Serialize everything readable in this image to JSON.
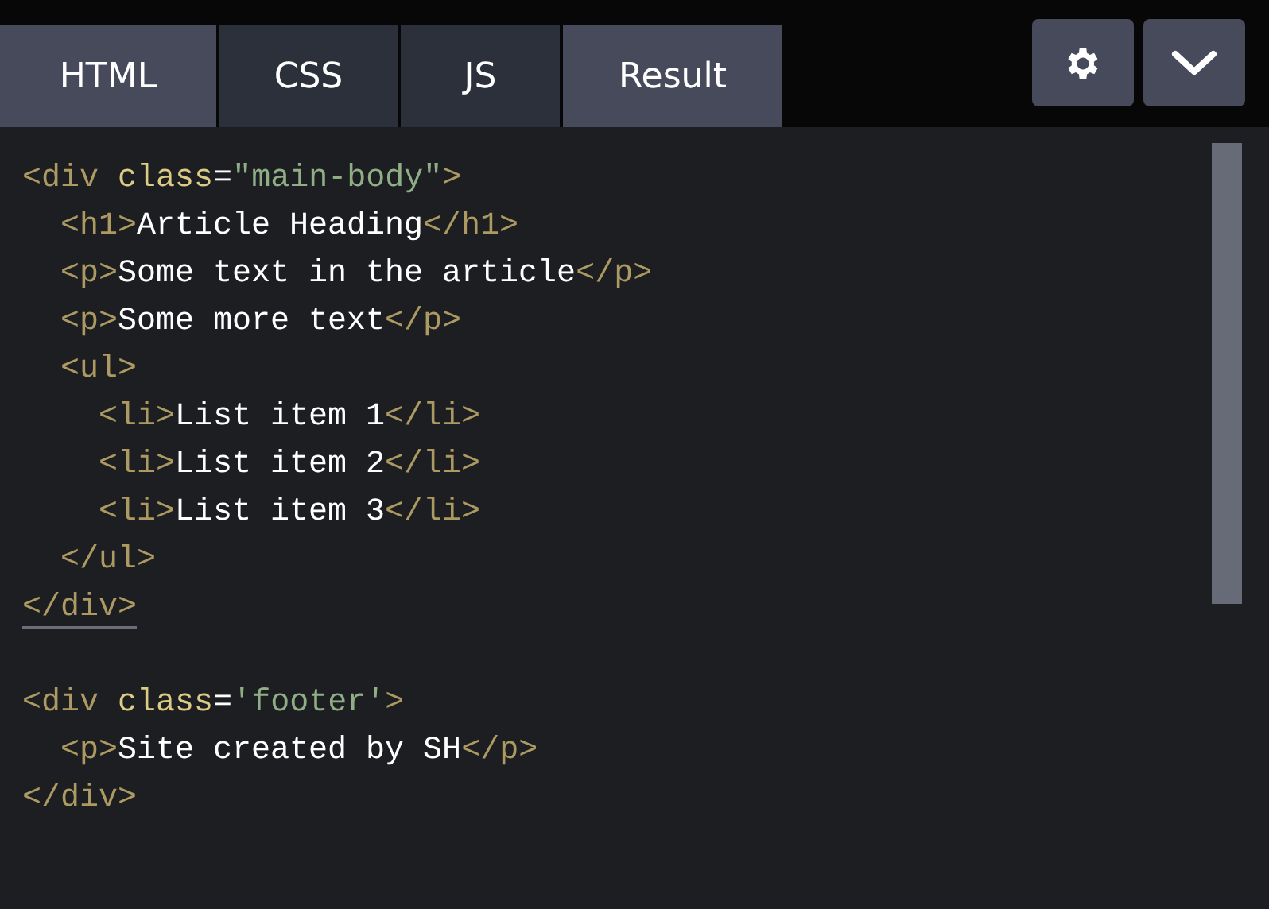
{
  "tabs": [
    {
      "label": "HTML",
      "selected": true
    },
    {
      "label": "CSS",
      "selected": false
    },
    {
      "label": "JS",
      "selected": false
    },
    {
      "label": "Result",
      "selected": true
    }
  ],
  "code_lines": [
    {
      "kind": "code",
      "matched": false,
      "tokens": [
        {
          "kind": "tag",
          "text": "<div"
        },
        {
          "kind": "attr",
          "text": "class"
        },
        {
          "kind": "text",
          "text": "="
        },
        {
          "kind": "string",
          "text": "\"main-body\""
        },
        {
          "kind": "tag",
          "text": ">"
        }
      ],
      "children": [
        {
          "kind": "code",
          "matched": false,
          "tokens": [
            {
              "kind": "tag",
              "text": "<h1>"
            },
            {
              "kind": "text",
              "text": "Article Heading"
            },
            {
              "kind": "tag",
              "text": "</h1>"
            }
          ]
        },
        {
          "kind": "code",
          "matched": false,
          "tokens": [
            {
              "kind": "tag",
              "text": "<p>"
            },
            {
              "kind": "text",
              "text": "Some text in the article"
            },
            {
              "kind": "tag",
              "text": "</p>"
            }
          ]
        },
        {
          "kind": "code",
          "matched": false,
          "tokens": [
            {
              "kind": "tag",
              "text": "<p>"
            },
            {
              "kind": "text",
              "text": "Some more text"
            },
            {
              "kind": "tag",
              "text": "</p>"
            }
          ]
        },
        {
          "kind": "code",
          "matched": false,
          "tokens": [
            {
              "kind": "tag",
              "text": "<ul>"
            }
          ],
          "children": [
            {
              "kind": "code",
              "matched": false,
              "tokens": [
                {
                  "kind": "tag",
                  "text": "<li>"
                },
                {
                  "kind": "text",
                  "text": "List item 1"
                },
                {
                  "kind": "tag",
                  "text": "</li>"
                }
              ]
            },
            {
              "kind": "code",
              "matched": false,
              "tokens": [
                {
                  "kind": "tag",
                  "text": "<li>"
                },
                {
                  "kind": "text",
                  "text": "List item 2"
                },
                {
                  "kind": "tag",
                  "text": "</li>"
                }
              ]
            },
            {
              "kind": "code",
              "matched": false,
              "tokens": [
                {
                  "kind": "tag",
                  "text": "<li>"
                },
                {
                  "kind": "text",
                  "text": "List item 3"
                },
                {
                  "kind": "tag",
                  "text": "</li>"
                }
              ]
            }
          ]
        },
        {
          "kind": "code",
          "matched": false,
          "tokens": [
            {
              "kind": "tag",
              "text": "</ul>"
            }
          ]
        }
      ]
    },
    {
      "kind": "code",
      "matched": true,
      "tokens": [
        {
          "kind": "tag",
          "text": "</div>"
        }
      ]
    },
    {
      "kind": "blank"
    },
    {
      "kind": "code",
      "matched": false,
      "tokens": [
        {
          "kind": "tag",
          "text": "<div"
        },
        {
          "kind": "attr",
          "text": "class"
        },
        {
          "kind": "text",
          "text": "="
        },
        {
          "kind": "string",
          "text": "'footer'"
        },
        {
          "kind": "tag",
          "text": ">"
        }
      ],
      "children": [
        {
          "kind": "code",
          "matched": false,
          "tokens": [
            {
              "kind": "tag",
              "text": "<p>"
            },
            {
              "kind": "text",
              "text": "Site created by SH"
            },
            {
              "kind": "tag",
              "text": "</p>"
            }
          ]
        }
      ]
    },
    {
      "kind": "code",
      "matched": false,
      "tokens": [
        {
          "kind": "tag",
          "text": "</div>"
        }
      ]
    }
  ]
}
